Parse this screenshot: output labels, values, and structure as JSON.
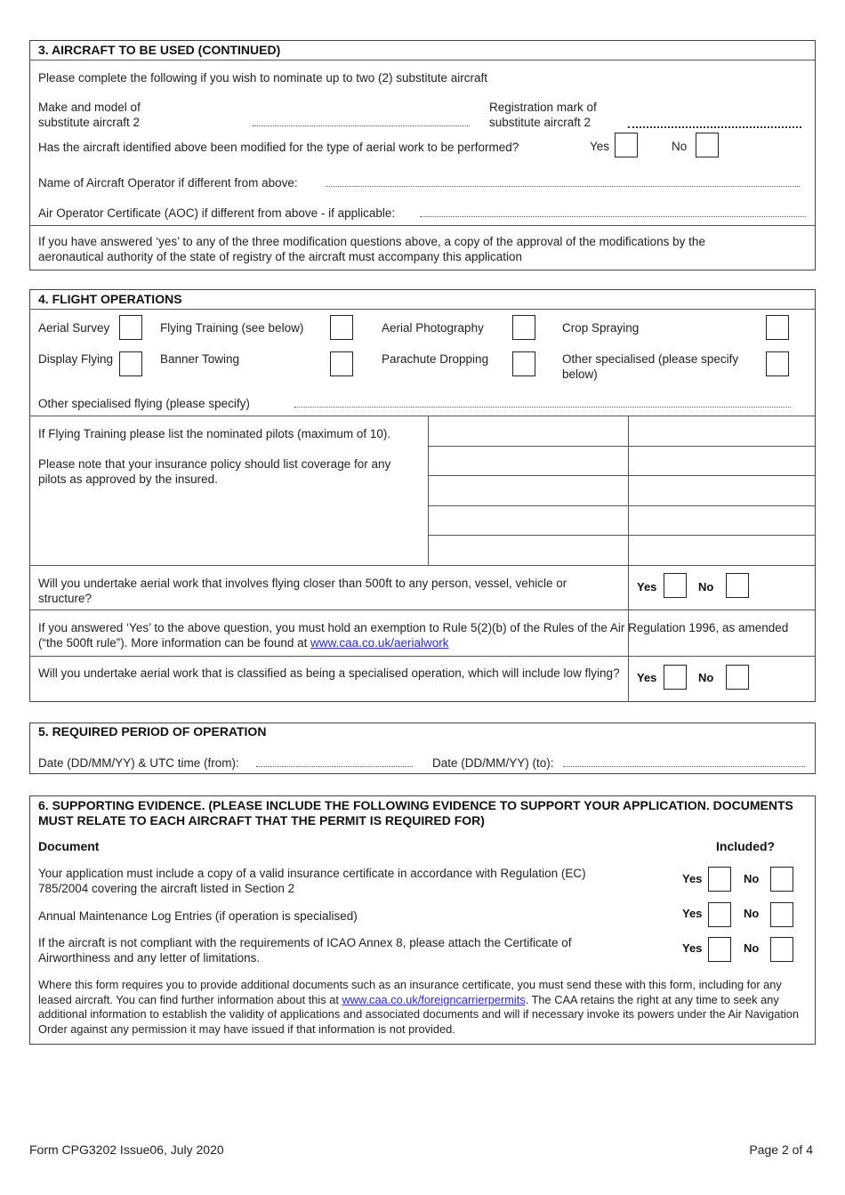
{
  "section3": {
    "title": "3. AIRCRAFT TO BE USED (CONTINUED)",
    "intro": "Please complete the following if you wish to nominate up to two (2) substitute aircraft",
    "make_model_label_1": "Make and model of",
    "make_model_label_2": "substitute aircraft 2",
    "make_model_value": "",
    "registration_label_1": "Registration mark of",
    "registration_label_2": "substitute aircraft 2",
    "registration_value": "",
    "modified_question": "Has the aircraft identified above been modified for the type of aerial work to be performed?",
    "yes_label": "Yes",
    "no_label": "No",
    "modified_yes": false,
    "modified_no": false,
    "operator_label": "Name of Aircraft Operator if different from above:",
    "operator_value": "",
    "aoc_label": "Air Operator Certificate (AOC) if different from above - if applicable:",
    "aoc_value": "",
    "note": "If you have answered ‘yes’ to any of the three modification questions above, a copy of the approval of the modifications by the aeronautical authority of the state of registry of the aircraft must accompany this application"
  },
  "section4": {
    "title": "4.  FLIGHT OPERATIONS",
    "operations": [
      {
        "label": "Aerial Survey",
        "checked": false
      },
      {
        "label": "Flying Training (see below)",
        "checked": false
      },
      {
        "label": "Aerial Photography",
        "checked": false
      },
      {
        "label": "Crop Spraying",
        "checked": false
      },
      {
        "label": "Display Flying",
        "checked": false
      },
      {
        "label": "Banner Towing",
        "checked": false
      },
      {
        "label": "Parachute Dropping",
        "checked": false
      },
      {
        "label": "Other specialised (please specify below)",
        "checked": false
      }
    ],
    "other_label": "Other specialised flying (please specify)",
    "other_value": "",
    "pilots_instruction": "If Flying Training please list the nominated pilots (maximum of 10).",
    "pilots_note": "Please note that your insurance policy should list coverage for any pilots as approved by the insured.",
    "pilots": [
      "",
      "",
      "",
      "",
      "",
      "",
      "",
      "",
      "",
      ""
    ],
    "q500_text": "Will you undertake aerial work that involves flying closer than 500ft to any person, vessel, vehicle or structure?",
    "q500_yes": false,
    "q500_no": false,
    "yes_label": "Yes",
    "no_label": "No",
    "exemption_text": "If you answered ‘Yes’ to the above question, you must hold an exemption to Rule 5(2)(b) of the Rules of the Air Regulation 1996, as amended (“the 500ft rule”). More information can be found at ",
    "exemption_link": "www.caa.co.uk/aerialwork",
    "specialised_text": "Will you undertake aerial work that is classified as being a specialised operation, which will include low flying?",
    "specialised_yes": false,
    "specialised_no": false
  },
  "section5": {
    "title": "5. REQUIRED PERIOD OF OPERATION",
    "from_label": "Date (DD/MM/YY) & UTC time (from):",
    "from_value": "",
    "to_label": "Date (DD/MM/YY) (to):",
    "to_value": ""
  },
  "section6": {
    "title": "6.  SUPPORTING EVIDENCE. (PLEASE INCLUDE THE FOLLOWING EVIDENCE TO SUPPORT YOUR APPLICATION. DOCUMENTS MUST RELATE TO EACH AIRCRAFT THAT THE PERMIT IS REQUIRED FOR)",
    "col_document": "Document",
    "col_included": "Included?",
    "yes_label": "Yes",
    "no_label": "No",
    "documents": [
      {
        "text": "Your application must include a copy of a valid insurance certificate in accordance with Regulation (EC) 785/2004 covering the aircraft listed in Section 2",
        "yes": false,
        "no": false
      },
      {
        "text": "Annual Maintenance Log Entries (if operation is specialised)",
        "yes": false,
        "no": false
      },
      {
        "text": "If the aircraft is not compliant with the requirements of ICAO Annex 8, please attach the Certificate of Airworthiness and any letter of limitations.",
        "yes": false,
        "no": false
      }
    ],
    "footer_text_1": "Where this form requires you to provide additional documents such as an insurance certificate, you must send these with this form, including for any leased aircraft. You can find further information about this at ",
    "footer_link": "www.caa.co.uk/foreigncarrierpermits",
    "footer_text_2": ". The CAA retains the right at any time to seek any additional information to establish the validity of applications and associated documents and will if necessary invoke its powers under the Air Navigation Order against any permission it may have issued if that information is not provided."
  },
  "footer": {
    "form_id": "Form CPG3202 Issue06, July 2020",
    "page": "Page 2 of 4"
  }
}
